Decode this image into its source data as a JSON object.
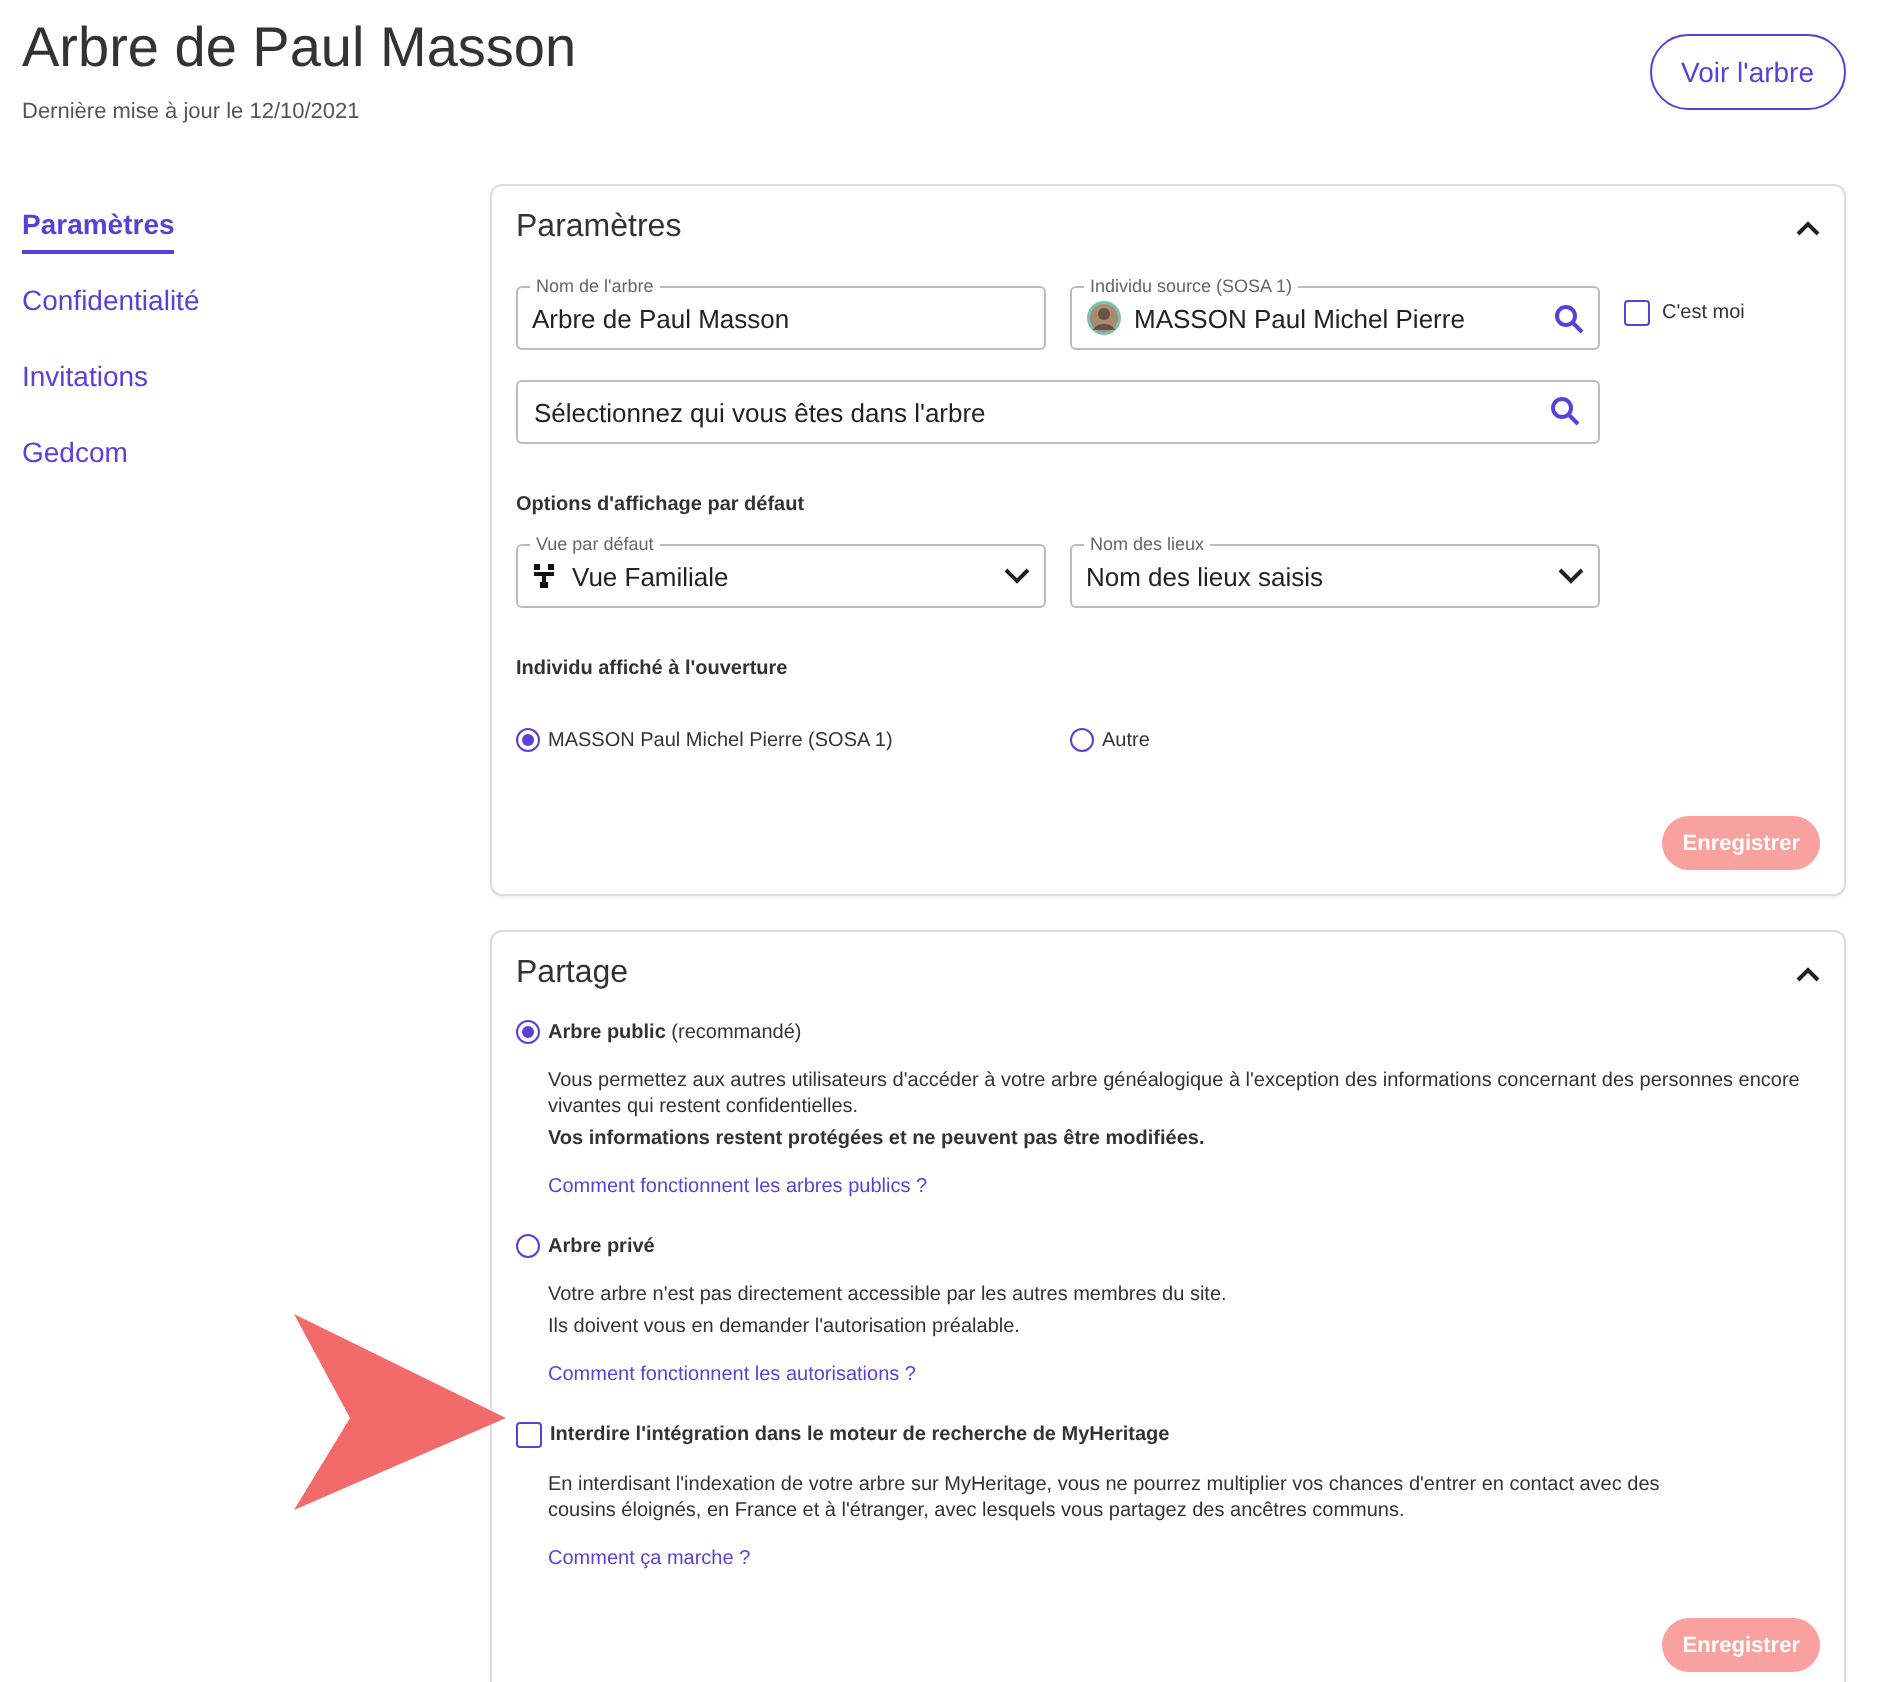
{
  "header": {
    "title": "Arbre de Paul Masson",
    "subtitle": "Dernière mise à jour le 12/10/2021",
    "button": "Voir l'arbre"
  },
  "sidebar": {
    "items": [
      {
        "label": "Paramètres",
        "selected": true
      },
      {
        "label": "Confidentialité",
        "selected": false
      },
      {
        "label": "Invitations",
        "selected": false
      },
      {
        "label": "Gedcom",
        "selected": false
      }
    ]
  },
  "settings": {
    "title": "Paramètres",
    "expanded": true,
    "tree_name": {
      "label": "Nom de l'arbre",
      "value": "Arbre de Paul Masson"
    },
    "source": {
      "label": "Individu source (SOSA 1)",
      "value": "MASSON Paul Michel Pierre"
    },
    "its_me": {
      "label": "C'est moi",
      "checked": false
    },
    "who_search": {
      "placeholder": "Sélectionnez qui vous êtes dans l'arbre"
    },
    "display_heading": "Options d'affichage par défaut",
    "default_view": {
      "label": "Vue par défaut",
      "value": "Vue Familiale"
    },
    "place_names": {
      "label": "Nom des lieux",
      "value": "Nom des lieux saisis"
    },
    "opening_heading": "Individu affiché à l'ouverture",
    "opening_options": [
      {
        "label": "MASSON Paul Michel Pierre (SOSA 1)",
        "selected": true
      },
      {
        "label": "Autre",
        "selected": false
      }
    ],
    "save": {
      "label": "Enregistrer",
      "disabled": true
    }
  },
  "sharing": {
    "title": "Partage",
    "expanded": true,
    "options": [
      {
        "kind": "radio",
        "label": "**Arbre public** (recommandé)",
        "selected": true,
        "lines": [
          "Vous permettez aux autres utilisateurs d'accéder à votre arbre généalogique à l'exception des informations concernant des personnes encore vivantes qui restent confidentielles.",
          "**Vos informations restent protégées et ne peuvent pas être modifiées.**"
        ],
        "link": "Comment fonctionnent les arbres publics ?"
      },
      {
        "kind": "radio",
        "label": "**Arbre privé**",
        "selected": false,
        "lines": [
          "Votre arbre n'est pas directement accessible par les autres membres du site.",
          "Ils doivent vous en demander l'autorisation préalable."
        ],
        "link": "Comment fonctionnent les autorisations ?"
      },
      {
        "kind": "checkbox",
        "label": "**Interdire l'intégration dans le moteur de recherche de MyHeritage**",
        "checked": false,
        "lines": [
          "En interdisant l'indexation de votre arbre sur MyHeritage, vous ne pourrez multiplier vos chances d'entrer en contact avec des cousins éloignés, en France et à l'étranger, avec lesquels vous partagez des ancêtres communs."
        ],
        "link": "Comment ça marche ?"
      }
    ],
    "save": {
      "label": "Enregistrer",
      "disabled": true
    }
  }
}
